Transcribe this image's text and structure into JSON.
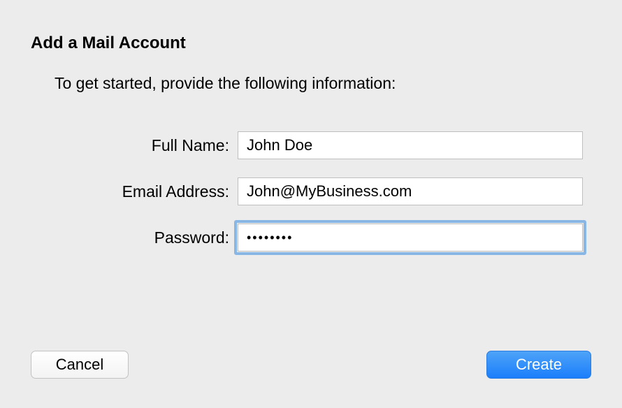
{
  "dialog": {
    "title": "Add a Mail Account",
    "subtitle": "To get started, provide the following information:"
  },
  "form": {
    "fullName": {
      "label": "Full Name:",
      "value": "John Doe"
    },
    "email": {
      "label": "Email Address:",
      "value": "John@MyBusiness.com"
    },
    "password": {
      "label": "Password:",
      "value": "••••••••"
    }
  },
  "buttons": {
    "cancel": "Cancel",
    "create": "Create"
  }
}
